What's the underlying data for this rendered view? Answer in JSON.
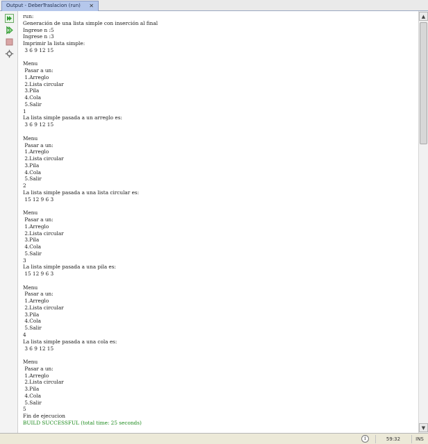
{
  "tab": {
    "title": "Output - DeberTraslacion (run)",
    "close_glyph": "✕"
  },
  "toolbar": {
    "buttons": [
      {
        "name": "rerun-icon",
        "color": "#2e9a2e"
      },
      {
        "name": "rerun-with-args-icon",
        "color": "#2e9a2e"
      },
      {
        "name": "stop-icon",
        "color": "#c98a8a"
      },
      {
        "name": "settings-icon",
        "color": "#707070"
      }
    ]
  },
  "output": {
    "lines": [
      {
        "text": "run:",
        "kind": "normal"
      },
      {
        "text": "Generación de una lista simple con inserción al final",
        "kind": "normal"
      },
      {
        "text": "Ingrese n :5",
        "kind": "normal"
      },
      {
        "text": "Ingrese n :3",
        "kind": "normal"
      },
      {
        "text": "Imprimir la lista simple:",
        "kind": "normal"
      },
      {
        "text": " 3 6 9 12 15",
        "kind": "normal"
      },
      {
        "text": "",
        "kind": "normal"
      },
      {
        "text": "Menu",
        "kind": "normal"
      },
      {
        "text": " Pasar a un:",
        "kind": "normal"
      },
      {
        "text": " 1.Arreglo",
        "kind": "normal"
      },
      {
        "text": " 2.Lista circular",
        "kind": "normal"
      },
      {
        "text": " 3.Pila",
        "kind": "normal"
      },
      {
        "text": " 4.Cola",
        "kind": "normal"
      },
      {
        "text": " 5.Salir",
        "kind": "normal"
      },
      {
        "text": "1",
        "kind": "normal"
      },
      {
        "text": "La lista simple pasada a un arreglo es:",
        "kind": "normal"
      },
      {
        "text": " 3 6 9 12 15",
        "kind": "normal"
      },
      {
        "text": "",
        "kind": "normal"
      },
      {
        "text": "Menu",
        "kind": "normal"
      },
      {
        "text": " Pasar a un:",
        "kind": "normal"
      },
      {
        "text": " 1.Arreglo",
        "kind": "normal"
      },
      {
        "text": " 2.Lista circular",
        "kind": "normal"
      },
      {
        "text": " 3.Pila",
        "kind": "normal"
      },
      {
        "text": " 4.Cola",
        "kind": "normal"
      },
      {
        "text": " 5.Salir",
        "kind": "normal"
      },
      {
        "text": "2",
        "kind": "normal"
      },
      {
        "text": "La lista simple pasada a una lista circular es:",
        "kind": "normal"
      },
      {
        "text": " 15 12 9 6 3",
        "kind": "normal"
      },
      {
        "text": "",
        "kind": "normal"
      },
      {
        "text": "Menu",
        "kind": "normal"
      },
      {
        "text": " Pasar a un:",
        "kind": "normal"
      },
      {
        "text": " 1.Arreglo",
        "kind": "normal"
      },
      {
        "text": " 2.Lista circular",
        "kind": "normal"
      },
      {
        "text": " 3.Pila",
        "kind": "normal"
      },
      {
        "text": " 4.Cola",
        "kind": "normal"
      },
      {
        "text": " 5.Salir",
        "kind": "normal"
      },
      {
        "text": "3",
        "kind": "normal"
      },
      {
        "text": "La lista simple pasada a una pila es:",
        "kind": "normal"
      },
      {
        "text": " 15 12 9 6 3",
        "kind": "normal"
      },
      {
        "text": "",
        "kind": "normal"
      },
      {
        "text": "Menu",
        "kind": "normal"
      },
      {
        "text": " Pasar a un:",
        "kind": "normal"
      },
      {
        "text": " 1.Arreglo",
        "kind": "normal"
      },
      {
        "text": " 2.Lista circular",
        "kind": "normal"
      },
      {
        "text": " 3.Pila",
        "kind": "normal"
      },
      {
        "text": " 4.Cola",
        "kind": "normal"
      },
      {
        "text": " 5.Salir",
        "kind": "normal"
      },
      {
        "text": "4",
        "kind": "normal"
      },
      {
        "text": "La lista simple pasada a una cola es:",
        "kind": "normal"
      },
      {
        "text": " 3 6 9 12 15",
        "kind": "normal"
      },
      {
        "text": "",
        "kind": "normal"
      },
      {
        "text": "Menu",
        "kind": "normal"
      },
      {
        "text": " Pasar a un:",
        "kind": "normal"
      },
      {
        "text": " 1.Arreglo",
        "kind": "normal"
      },
      {
        "text": " 2.Lista circular",
        "kind": "normal"
      },
      {
        "text": " 3.Pila",
        "kind": "normal"
      },
      {
        "text": " 4.Cola",
        "kind": "normal"
      },
      {
        "text": " 5.Salir",
        "kind": "normal"
      },
      {
        "text": "5",
        "kind": "normal"
      },
      {
        "text": "Fin de ejecucion",
        "kind": "normal"
      },
      {
        "text": "BUILD SUCCESSFUL (total time: 25 seconds)",
        "kind": "success"
      }
    ]
  },
  "statusbar": {
    "info_glyph": "i",
    "position": "59:32",
    "mode": "INS"
  },
  "colors": {
    "success_text": "#1b8a1b",
    "tab_bg": "#b5c7eb"
  }
}
